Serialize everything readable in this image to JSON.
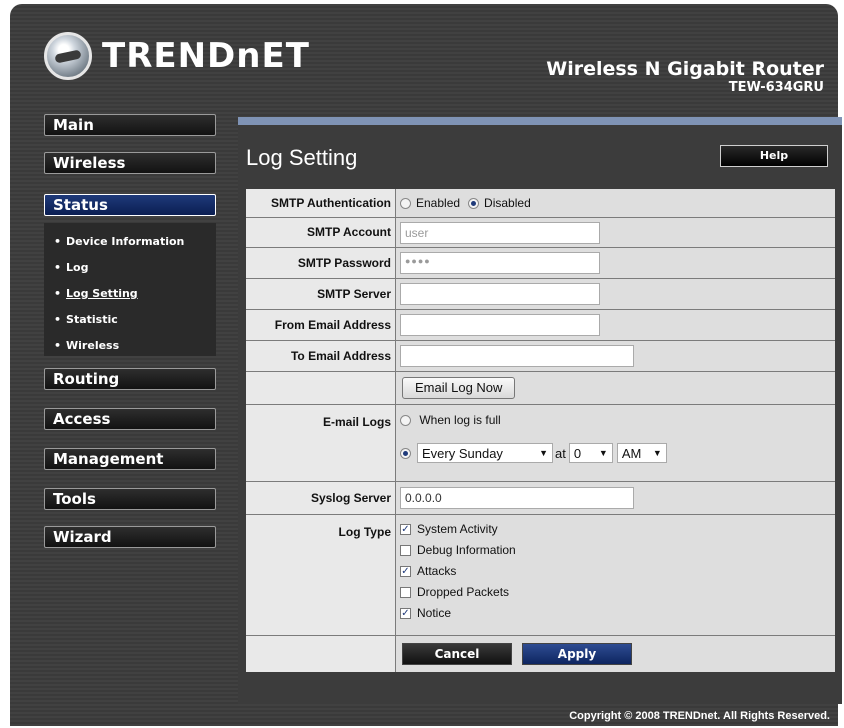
{
  "brand": {
    "logo_text": "TRENDnET",
    "product_name": "Wireless N Gigabit Router",
    "model": "TEW-634GRU"
  },
  "nav": {
    "main": "Main",
    "wireless": "Wireless",
    "status": "Status",
    "status_items": [
      "Device Information",
      "Log",
      "Log Setting",
      "Statistic",
      "Wireless"
    ],
    "routing": "Routing",
    "access": "Access",
    "management": "Management",
    "tools": "Tools",
    "wizard": "Wizard"
  },
  "page": {
    "title": "Log Setting",
    "help_label": "Help"
  },
  "form": {
    "smtp_auth": {
      "label": "SMTP Authentication",
      "options": [
        "Enabled",
        "Disabled"
      ],
      "selected": "Disabled"
    },
    "smtp_account": {
      "label": "SMTP Account",
      "value": "user"
    },
    "smtp_password": {
      "label": "SMTP Password",
      "value": "●●●●"
    },
    "smtp_server": {
      "label": "SMTP Server",
      "value": ""
    },
    "from_email": {
      "label": "From Email Address",
      "value": ""
    },
    "to_email": {
      "label": "To Email Address",
      "value": ""
    },
    "email_log_now": "Email Log Now",
    "email_logs": {
      "label": "E-mail Logs",
      "option_full": "When log is full",
      "schedule": "Every Sunday",
      "at_label": "at",
      "hour": "0",
      "ampm": "AM"
    },
    "syslog_server": {
      "label": "Syslog Server",
      "value": "0.0.0.0"
    },
    "log_type": {
      "label": "Log Type",
      "items": [
        {
          "label": "System Activity",
          "checked": "✓"
        },
        {
          "label": "Debug Information",
          "checked": ""
        },
        {
          "label": "Attacks",
          "checked": "✓"
        },
        {
          "label": "Dropped Packets",
          "checked": ""
        },
        {
          "label": "Notice",
          "checked": "✓"
        }
      ]
    },
    "cancel_label": "Cancel",
    "apply_label": "Apply"
  },
  "footer": {
    "copyright": "Copyright © 2008 TRENDnet. All Rights Reserved."
  },
  "colors": {
    "active_nav": "#1f3a7a",
    "content_top_bar": "#7f93b5",
    "background": "#3a3a3a"
  }
}
